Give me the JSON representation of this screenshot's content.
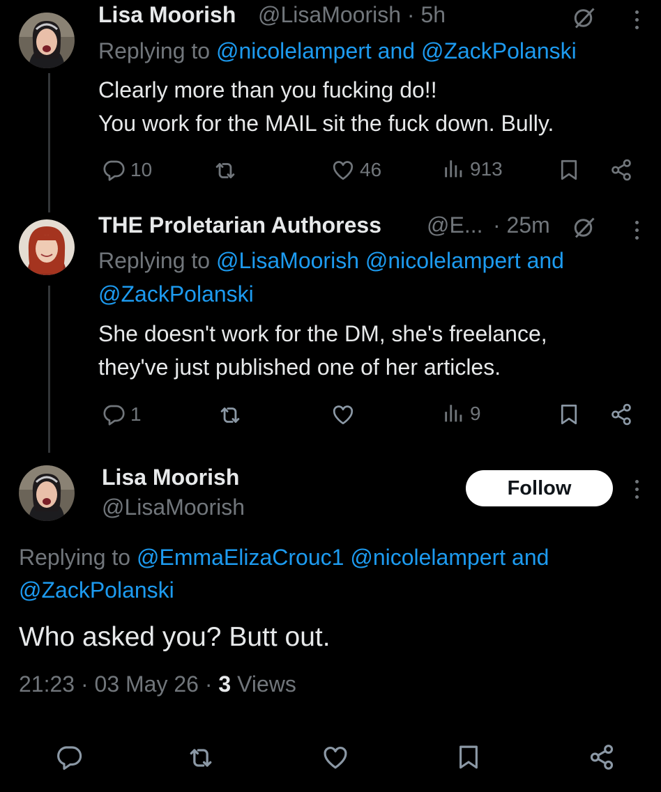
{
  "tweets": [
    {
      "name": "Lisa Moorish",
      "handle": "@LisaMoorish",
      "time": "· 5h",
      "replying_prefix": "Replying to",
      "replying_line1": "@nicolelampert and @ZackPolanski",
      "text_line1": "Clearly more than you fucking do!!",
      "text_line2": "You work for the MAIL sit the fuck down. Bully.",
      "replies": "10",
      "likes": "46",
      "views": "913"
    },
    {
      "name": "THE Proletarian Authoress",
      "handle": "@E...",
      "time": "· 25m",
      "replying_prefix": "Replying to",
      "replying_line1": "@LisaMoorish @nicolelampert and",
      "replying_line2": "@ZackPolanski",
      "text_line1": "She doesn't work for the DM, she's freelance,",
      "text_line2": "they've just published one of her articles.",
      "replies": "1",
      "views": "9"
    }
  ],
  "main_tweet": {
    "name": "Lisa Moorish",
    "handle": "@LisaMoorish",
    "follow_label": "Follow",
    "replying_prefix": "Replying to",
    "replying_line1": "@EmmaElizaCrouc1 @nicolelampert and",
    "replying_line2": "@ZackPolanski",
    "text": "Who asked you? Butt out.",
    "time": "21:23",
    "date": "03 May 26",
    "views_count": "3",
    "views_label": "Views"
  },
  "icons": {
    "reply": "reply-icon",
    "retweet": "retweet-icon",
    "like": "heart-icon",
    "views": "views-icon",
    "bookmark": "bookmark-icon",
    "share": "share-icon",
    "grok": "grok-icon",
    "more": "more-icon"
  },
  "colors": {
    "background": "#000000",
    "link": "#1d9bf0",
    "muted": "#71767b",
    "text": "#e7e9ea"
  }
}
